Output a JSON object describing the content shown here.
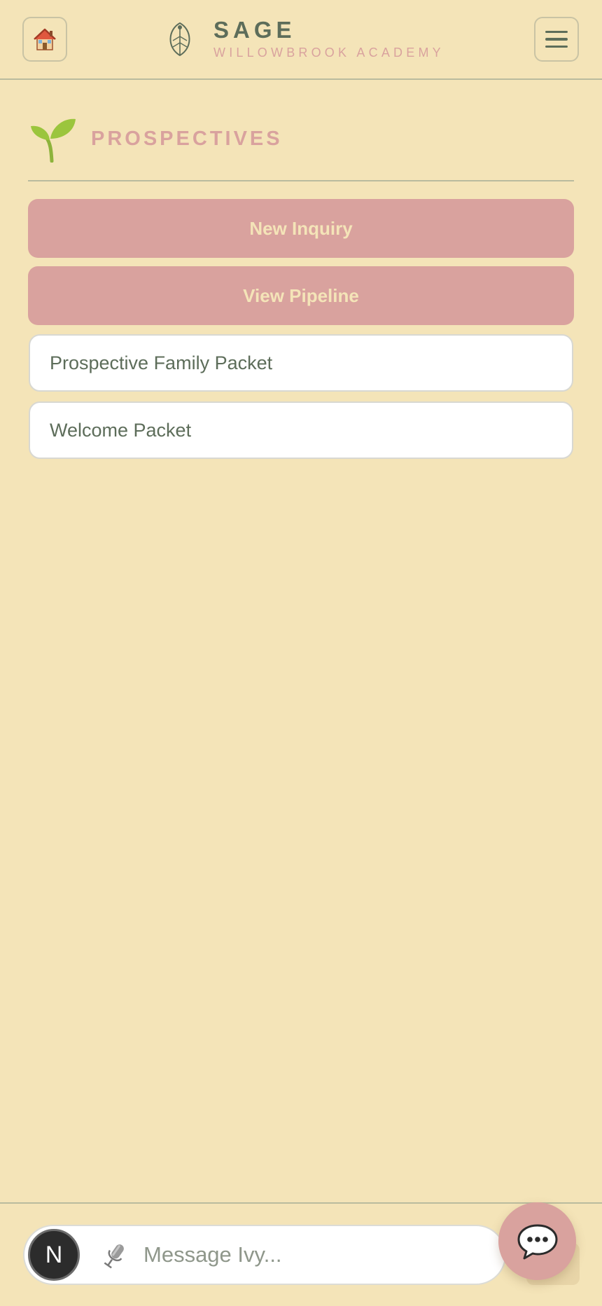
{
  "header": {
    "brand_name": "SAGE",
    "brand_subtitle": "WILLOWBROOK ACADEMY",
    "home_icon": "house-icon",
    "menu_icon": "hamburger-menu-icon",
    "logo_icon": "leaf-icon"
  },
  "section": {
    "icon": "seedling-icon",
    "title": "PROSPECTIVES"
  },
  "actions": [
    {
      "label": "New Inquiry"
    },
    {
      "label": "View Pipeline"
    }
  ],
  "documents": [
    {
      "label": "Prospective Family Packet"
    },
    {
      "label": "Welcome Packet"
    }
  ],
  "chat": {
    "avatar_letter": "N",
    "placeholder": "Message Ivy...",
    "value": ""
  },
  "colors": {
    "background": "#f4e4b8",
    "accent_pink": "#d9a29e",
    "text_green": "#5d6d5a"
  }
}
